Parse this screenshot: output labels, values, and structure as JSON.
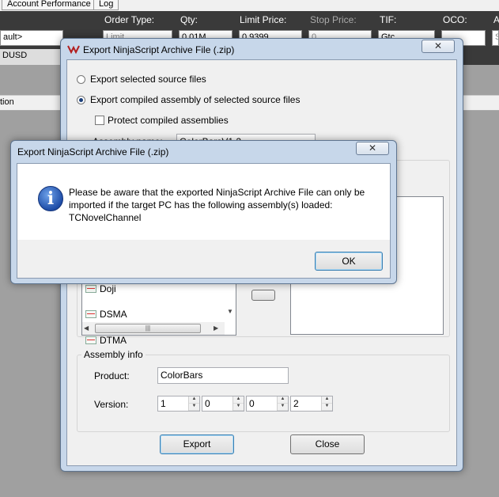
{
  "background_app": {
    "tabs": [
      "Account Performance",
      "Log"
    ],
    "order_labels": [
      "Order Type:",
      "Qty:",
      "Limit Price:",
      "Stop Price:",
      "TIF:",
      "OCO:",
      "A"
    ],
    "fields": {
      "account": "ault>",
      "order_type": "Limit",
      "qty": "0.01M",
      "limit_price": "0.9399",
      "stop_price": "0",
      "tif": "Gtc",
      "oco": "",
      "extra": "S"
    },
    "instrument": "DUSD",
    "column_header": "tion"
  },
  "export_dialog": {
    "title": "Export NinjaScript Archive File (.zip)",
    "close_symbol": "✕",
    "options": {
      "source_label": "Export selected source files",
      "compiled_label": "Export compiled assembly of selected source files",
      "selected": "compiled"
    },
    "protect_label": "Protect compiled assemblies",
    "protect_checked": false,
    "assembly_name_label": "Assembly name:",
    "assembly_name_value": "ColorBarsV1.2",
    "indicator_list": [
      "Doji",
      "DSMA",
      "DTMA"
    ],
    "assembly_info": {
      "legend": "Assembly info",
      "product_label": "Product:",
      "product_value": "ColorBars",
      "version_label": "Version:",
      "version": [
        "1",
        "0",
        "0",
        "2"
      ]
    },
    "export_button": "Export",
    "close_button": "Close"
  },
  "message_box": {
    "title": "Export NinjaScript Archive File (.zip)",
    "close_symbol": "✕",
    "message_line1": "Please be aware that the exported NinjaScript Archive File can only be",
    "message_line2": "imported if the target PC has the following assembly(s) loaded:",
    "message_line3": "TCNovelChannel",
    "ok_button": "OK"
  },
  "colors": {
    "title_bar": "#c7d7ea",
    "dialog_face": "#f0f0f0",
    "dark_toolbar": "#3a3a3a",
    "desktop": "#a0a0a0",
    "info_blue": "#1f4ea8"
  }
}
